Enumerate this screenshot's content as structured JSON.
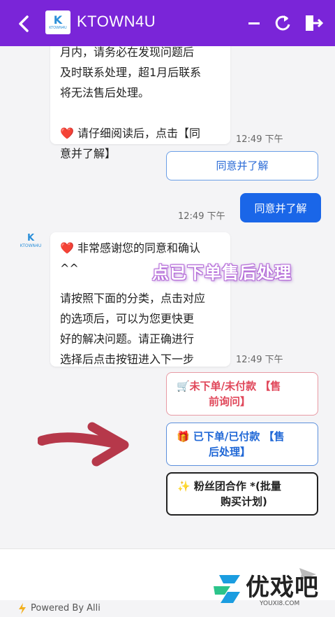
{
  "header": {
    "title": "KTOWN4U",
    "logo_letter": "K",
    "logo_sub": "KTOWN4U",
    "icons": [
      "back-icon",
      "minimize-icon",
      "refresh-icon",
      "exit-icon"
    ]
  },
  "messages": {
    "top_bubble_lines": [
      "月内，请务必在发现问题后",
      "及时联系处理，超1月后联系",
      "将无法售后处理。",
      "",
      "❤️ 请仔细阅读后，点击【同",
      "意并了解】"
    ],
    "top_time": "12:49 下午",
    "agree_option": "同意并了解",
    "user_reply": "同意并了解",
    "user_time": "12:49 下午",
    "avatar_letter": "K",
    "avatar_sub": "KTOWN4U",
    "second_bubble_lines": [
      "❤️ 非常感谢您的同意和确认",
      "^^",
      "",
      "请按照下面的分类，点击对应",
      "的选项后，可以为您更快更",
      "好的解决问题。请正确进行",
      "选择后点击按钮进入下一步"
    ],
    "second_time": "12:49 下午",
    "overlay_caption": "点已下单售后处理",
    "options": [
      {
        "lines": [
          "🛒未下单/未付款 【售",
          "前询问】"
        ],
        "color": "#e0475a",
        "border": "#e89aa4"
      },
      {
        "lines": [
          "🎁 已下单/已付款 【售",
          "后处理】"
        ],
        "color": "#1f67d6",
        "border": "#5b8fdc"
      },
      {
        "lines": [
          "✨ 粉丝团合作 *(批量",
          "购买计划)"
        ],
        "color": "#222222",
        "border": "#222222"
      }
    ]
  },
  "input": {
    "placeholder": ""
  },
  "footer": {
    "powered": "Powered By Alli"
  },
  "watermark": {
    "text": "优戏吧",
    "sub": "YOUXI8.COM"
  },
  "colors": {
    "header": "#7a25d8",
    "user_bubble": "#1a66e8",
    "arrow": "#b6384a"
  }
}
